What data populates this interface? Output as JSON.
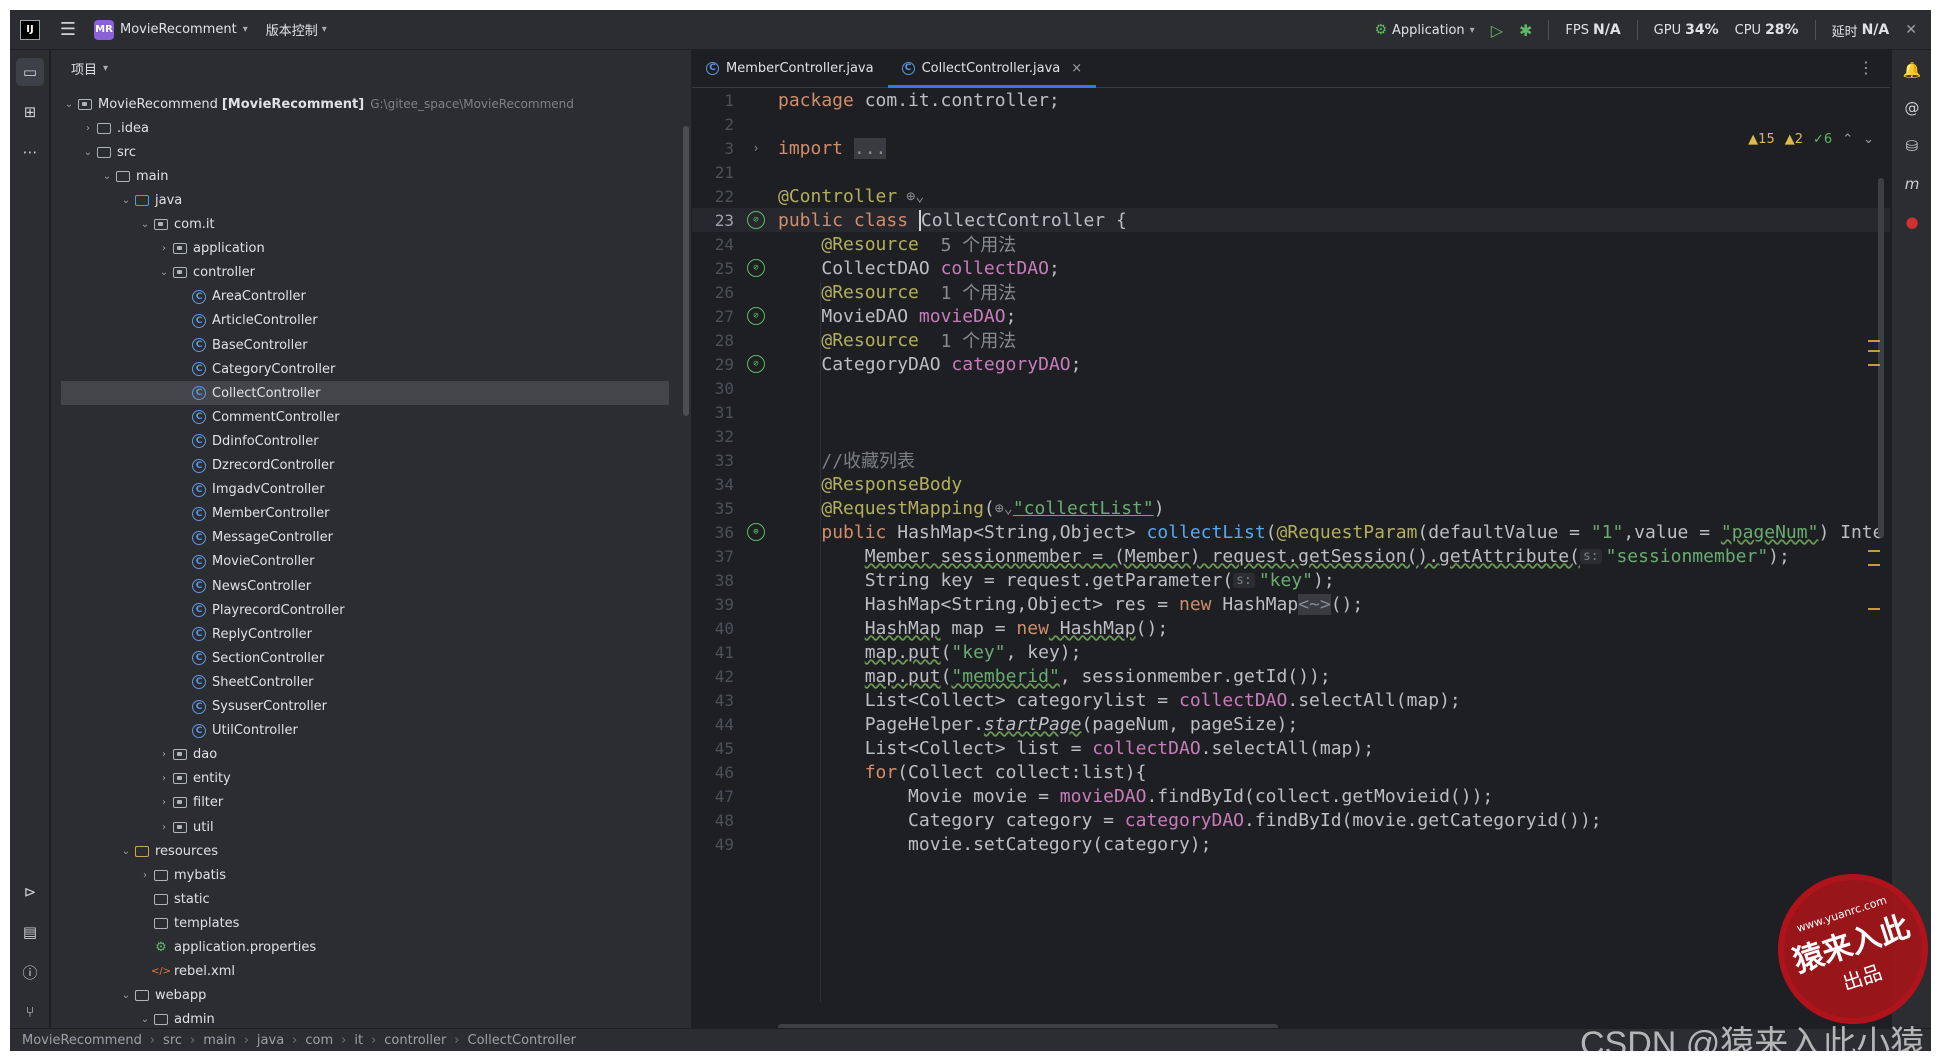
{
  "titlebar": {
    "project_badge": "MR",
    "project_name": "MovieRecomment",
    "vcs_label": "版本控制",
    "run_config": "Application",
    "fps_label": "FPS",
    "fps_value": "N/A",
    "gpu_label": "GPU",
    "gpu_value": "34%",
    "cpu_label": "CPU",
    "cpu_value": "28%",
    "time_label": "延时",
    "time_value": "N/A"
  },
  "project_panel": {
    "header": "项目",
    "tree": [
      {
        "label": "MovieRecommend",
        "extra": "[MovieRecomment]",
        "path": "G:\\gitee_space\\MovieRecommend",
        "depth": 0,
        "arrow": "open",
        "icon": "module-icon"
      },
      {
        "label": ".idea",
        "depth": 1,
        "arrow": "closed",
        "icon": "folder-icon"
      },
      {
        "label": "src",
        "depth": 1,
        "arrow": "open",
        "icon": "folder-icon"
      },
      {
        "label": "main",
        "depth": 2,
        "arrow": "open",
        "icon": "folder-icon"
      },
      {
        "label": "java",
        "depth": 3,
        "arrow": "open",
        "icon": "source-folder-icon"
      },
      {
        "label": "com.it",
        "depth": 4,
        "arrow": "open",
        "icon": "package-icon"
      },
      {
        "label": "application",
        "depth": 5,
        "arrow": "closed",
        "icon": "package-icon"
      },
      {
        "label": "controller",
        "depth": 5,
        "arrow": "open",
        "icon": "package-icon"
      },
      {
        "label": "AreaController",
        "depth": 6,
        "icon": "class-icon"
      },
      {
        "label": "ArticleController",
        "depth": 6,
        "icon": "class-icon"
      },
      {
        "label": "BaseController",
        "depth": 6,
        "icon": "class-icon"
      },
      {
        "label": "CategoryController",
        "depth": 6,
        "icon": "class-icon"
      },
      {
        "label": "CollectController",
        "depth": 6,
        "icon": "class-icon",
        "selected": true
      },
      {
        "label": "CommentController",
        "depth": 6,
        "icon": "class-icon"
      },
      {
        "label": "DdinfoController",
        "depth": 6,
        "icon": "class-icon"
      },
      {
        "label": "DzrecordController",
        "depth": 6,
        "icon": "class-icon"
      },
      {
        "label": "ImgadvController",
        "depth": 6,
        "icon": "class-icon"
      },
      {
        "label": "MemberController",
        "depth": 6,
        "icon": "class-icon"
      },
      {
        "label": "MessageController",
        "depth": 6,
        "icon": "class-icon"
      },
      {
        "label": "MovieController",
        "depth": 6,
        "icon": "class-icon"
      },
      {
        "label": "NewsController",
        "depth": 6,
        "icon": "class-icon"
      },
      {
        "label": "PlayrecordController",
        "depth": 6,
        "icon": "class-icon"
      },
      {
        "label": "ReplyController",
        "depth": 6,
        "icon": "class-icon"
      },
      {
        "label": "SectionController",
        "depth": 6,
        "icon": "class-icon"
      },
      {
        "label": "SheetController",
        "depth": 6,
        "icon": "class-icon"
      },
      {
        "label": "SysuserController",
        "depth": 6,
        "icon": "class-icon"
      },
      {
        "label": "UtilController",
        "depth": 6,
        "icon": "class-icon"
      },
      {
        "label": "dao",
        "depth": 5,
        "arrow": "closed",
        "icon": "package-icon"
      },
      {
        "label": "entity",
        "depth": 5,
        "arrow": "closed",
        "icon": "package-icon"
      },
      {
        "label": "filter",
        "depth": 5,
        "arrow": "closed",
        "icon": "package-icon"
      },
      {
        "label": "util",
        "depth": 5,
        "arrow": "closed",
        "icon": "package-icon"
      },
      {
        "label": "resources",
        "depth": 3,
        "arrow": "open",
        "icon": "resources-folder-icon"
      },
      {
        "label": "mybatis",
        "depth": 4,
        "arrow": "closed",
        "icon": "folder-icon"
      },
      {
        "label": "static",
        "depth": 4,
        "icon": "folder-icon"
      },
      {
        "label": "templates",
        "depth": 4,
        "icon": "folder-icon"
      },
      {
        "label": "application.properties",
        "depth": 4,
        "icon": "properties-file-icon"
      },
      {
        "label": "rebel.xml",
        "depth": 4,
        "icon": "xml-file-icon"
      },
      {
        "label": "webapp",
        "depth": 3,
        "arrow": "open",
        "icon": "web-folder-icon"
      },
      {
        "label": "admin",
        "depth": 4,
        "arrow": "open",
        "icon": "folder-icon"
      }
    ]
  },
  "editor": {
    "tabs": [
      {
        "label": "MemberController.java",
        "active": false
      },
      {
        "label": "CollectController.java",
        "active": true
      }
    ],
    "inspections": {
      "warnings": "15",
      "weak_warnings": "2",
      "ok": "6"
    },
    "line_numbers": [
      "1",
      "2",
      "3",
      "21",
      "22",
      "23",
      "24",
      "25",
      "26",
      "27",
      "28",
      "29",
      "30",
      "31",
      "32",
      "33",
      "34",
      "35",
      "36",
      "37",
      "38",
      "39",
      "40",
      "41",
      "42",
      "43",
      "44",
      "45",
      "46",
      "47",
      "48",
      "49"
    ],
    "code": {
      "l1_kw": "package",
      "l1_rest": " com.it.controller;",
      "l3_kw": "import",
      "l3_fold": "...",
      "l22_an": "@Controller",
      "l23_kw": "public class",
      "l23_cls": "CollectController",
      "l23_rest": " {",
      "l24_an": "@Resource",
      "l24_hint": "5 个用法",
      "l25_type": "CollectDAO ",
      "l25_fld": "collectDAO",
      "l25_rest": ";",
      "l26_an": "@Resource",
      "l26_hint": "1 个用法",
      "l27_type": "MovieDAO ",
      "l27_fld": "movieDAO",
      "l27_rest": ";",
      "l28_an": "@Resource",
      "l28_hint": "1 个用法",
      "l29_type": "CategoryDAO ",
      "l29_fld": "categoryDAO",
      "l29_rest": ";",
      "l33_cm": "//收藏列表",
      "l34_an": "@ResponseBody",
      "l35_an": "@RequestMapping",
      "l35_a": "(",
      "l35_str": "\"collectList\"",
      "l35_b": ")",
      "l36_kw": "public",
      "l36_a": " HashMap<String,Object> ",
      "l36_fn": "collectList",
      "l36_b": "(",
      "l36_an": "@RequestParam",
      "l36_c": "(defaultValue = ",
      "l36_s1": "\"1\"",
      "l36_d": ",value = ",
      "l36_s2": "\"pageNum\"",
      "l36_e": ") Inte",
      "l37_a": "Member sessionmember = (Member) request.getSession().getAttribute(",
      "l37_chip": "s:",
      "l37_str": "\"sessionmember\"",
      "l37_b": ");",
      "l38_a": "String key = request.getParameter(",
      "l38_chip": "s:",
      "l38_str": "\"key\"",
      "l38_b": ");",
      "l39_a": "HashMap<String,Object> res = ",
      "l39_kw": "new",
      "l39_b": " HashMap",
      "l39_hint": "<~>",
      "l39_c": "();",
      "l40_a": "HashMap",
      "l40_b": " map = ",
      "l40_kw": "new",
      "l40_c": " HashMap",
      "l40_d": "();",
      "l41_a": "map.put",
      "l41_b": "(",
      "l41_s": "\"key\"",
      "l41_c": ", key);",
      "l42_a": "map.put",
      "l42_b": "(",
      "l42_s": "\"memberid\"",
      "l42_c": ", sessionmember.getId());",
      "l43_a": "List<Collect> categorylist = ",
      "l43_fld": "collectDAO",
      "l43_b": ".selectAll(map);",
      "l44_a": "PageHelper.",
      "l44_fn": "startPage",
      "l44_b": "(pageNum, pageSize);",
      "l45_a": "List<Collect> list = ",
      "l45_fld": "collectDAO",
      "l45_b": ".selectAll(map);",
      "l46_kw": "for",
      "l46_a": "(Collect collect:list){",
      "l47_a": "Movie movie = ",
      "l47_fld": "movieDAO",
      "l47_b": ".findById(collect.getMovieid());",
      "l48_a": "Category category = ",
      "l48_fld": "categoryDAO",
      "l48_b": ".findById(movie.getCategoryid());",
      "l49_a": "movie.setCategory(category);"
    }
  },
  "breadcrumb": [
    "MovieRecommend",
    "src",
    "main",
    "java",
    "com",
    "it",
    "controller",
    "CollectController"
  ],
  "watermark": {
    "csdn": "CSDN @猿来入此小猿",
    "stamp_url": "www.yuanrc.com",
    "stamp_main": "猿来入此",
    "stamp_sub": "出品"
  },
  "colors": {
    "accent": "#3574f0",
    "keyword": "#cf8e6d",
    "string": "#6aab73",
    "annotation": "#b3ae60",
    "field": "#c77dbb",
    "function": "#56a8f5"
  }
}
